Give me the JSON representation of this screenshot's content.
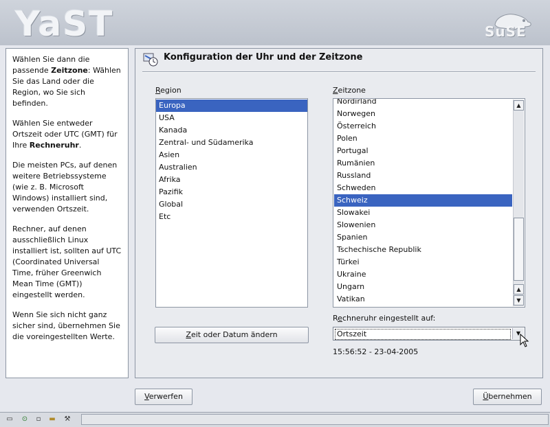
{
  "header": {
    "logo": "YaST",
    "brand": "SuSE"
  },
  "help": {
    "p1_pre": "Wählen Sie dann die passende ",
    "p1_bold": "Zeitzone",
    "p1_post": ": Wählen Sie das Land oder die Region, wo Sie sich befinden.",
    "p2_pre": "Wählen Sie entweder Ortszeit oder UTC (GMT) für Ihre ",
    "p2_bold": "Rechneruhr",
    "p2_post": ".",
    "p3": "Die meisten PCs, auf denen weitere Betriebssysteme (wie z. B. Microsoft Windows) installiert sind, verwenden Ortszeit.",
    "p4": "Rechner, auf denen ausschließlich Linux installiert ist, sollten auf UTC (Coordinated Universal Time, früher Greenwich Mean Time (GMT)) eingestellt werden.",
    "p5": "Wenn Sie sich nicht ganz sicher sind, übernehmen Sie die voreingestellten Werte."
  },
  "main": {
    "title": "Konfiguration der Uhr und der Zeitzone",
    "region_label_u": "R",
    "region_label_rest": "egion",
    "zone_label_u": "Z",
    "zone_label_rest": "eitzone",
    "regions": [
      "Europa",
      "USA",
      "Kanada",
      "Zentral- und Südamerika",
      "Asien",
      "Australien",
      "Afrika",
      "Pazifik",
      "Global",
      "Etc"
    ],
    "region_selected": "Europa",
    "zones": [
      "Nordirland",
      "Norwegen",
      "Österreich",
      "Polen",
      "Portugal",
      "Rumänien",
      "Russland",
      "Schweden",
      "Schweiz",
      "Slowakei",
      "Slowenien",
      "Spanien",
      "Tschechische Republik",
      "Türkei",
      "Ukraine",
      "Ungarn",
      "Vatikan"
    ],
    "zone_selected": "Schweiz",
    "change_button_u": "Z",
    "change_button_rest": "eit oder Datum ändern",
    "clock_label_pre": "R",
    "clock_label_u": "e",
    "clock_label_rest": "chneruhr eingestellt auf:",
    "clock_value": "Ortszeit",
    "datetime": "15:56:52 - 23-04-2005"
  },
  "footer": {
    "back_u": "V",
    "back_rest": "erwerfen",
    "accept_u": "Ü",
    "accept_rest": "bernehmen"
  },
  "taskbar": {
    "icons": [
      "drive-icon",
      "power-icon",
      "window-icon",
      "folder-icon",
      "tools-icon"
    ]
  },
  "colors": {
    "selection": "#3a64c0",
    "background": "#e6e8ee"
  }
}
